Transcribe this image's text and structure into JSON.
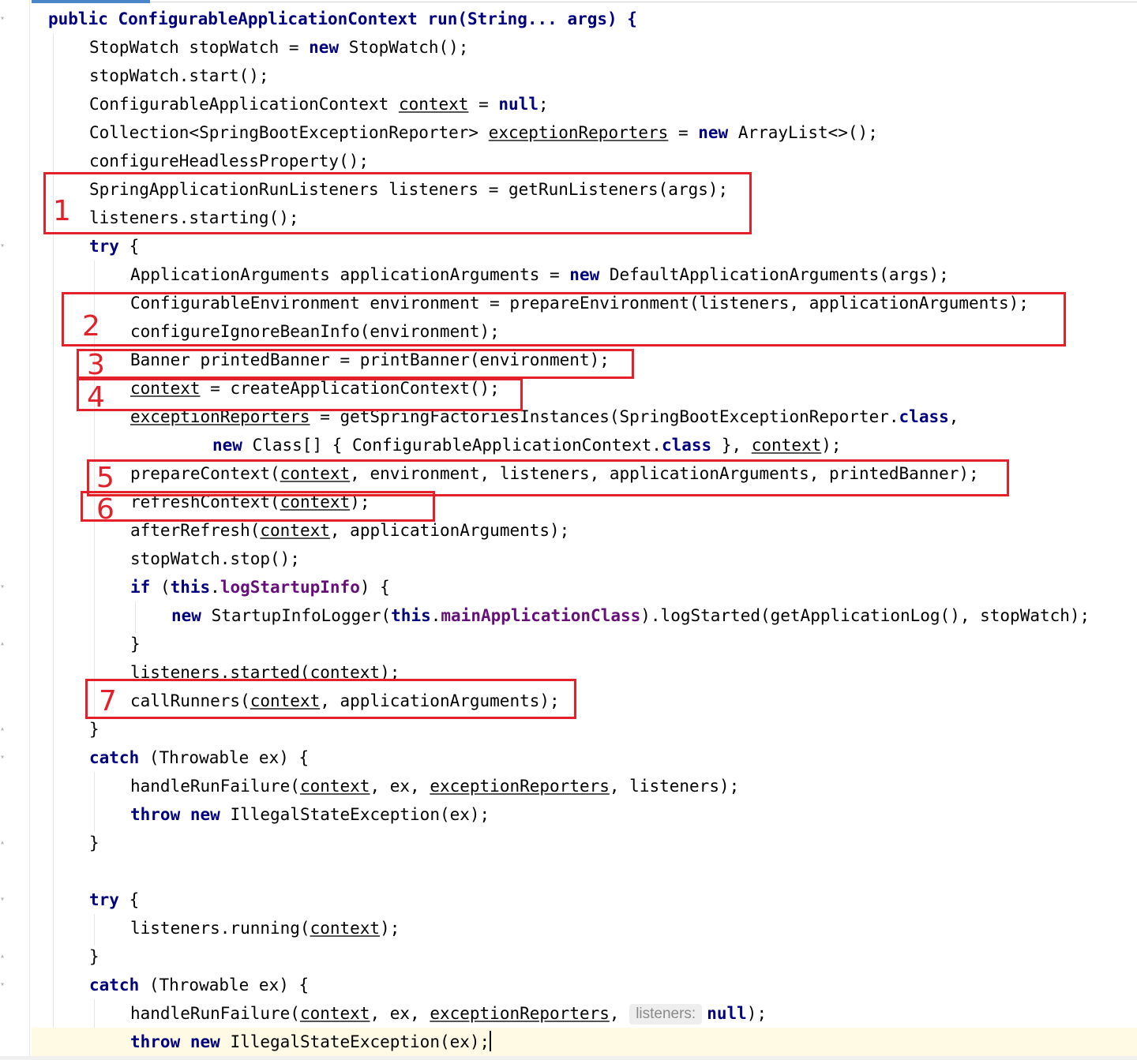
{
  "editor": {
    "lines": [
      "public ConfigurableApplicationContext run(String... args) {",
      "StopWatch stopWatch = new StopWatch();",
      "stopWatch.start();",
      "ConfigurableApplicationContext context = null;",
      "Collection<SpringBootExceptionReporter> exceptionReporters = new ArrayList<>();",
      "configureHeadlessProperty();",
      "SpringApplicationRunListeners listeners = getRunListeners(args);",
      "listeners.starting();",
      "try {",
      "ApplicationArguments applicationArguments = new DefaultApplicationArguments(args);",
      "ConfigurableEnvironment environment = prepareEnvironment(listeners, applicationArguments);",
      "configureIgnoreBeanInfo(environment);",
      "Banner printedBanner = printBanner(environment);",
      "context = createApplicationContext();",
      "exceptionReporters = getSpringFactoriesInstances(SpringBootExceptionReporter.class,",
      "new Class[] { ConfigurableApplicationContext.class }, context);",
      "prepareContext(context, environment, listeners, applicationArguments, printedBanner);",
      "refreshContext(context);",
      "afterRefresh(context, applicationArguments);",
      "stopWatch.stop();",
      "if (this.logStartupInfo) {",
      "new StartupInfoLogger(this.mainApplicationClass).logStarted(getApplicationLog(), stopWatch);",
      "}",
      "listeners.started(context);",
      "callRunners(context, applicationArguments);",
      "}",
      "catch (Throwable ex) {",
      "handleRunFailure(context, ex, exceptionReporters, listeners);",
      "throw new IllegalStateException(ex);",
      "}",
      "",
      "try {",
      "listeners.running(context);",
      "}",
      "catch (Throwable ex) {",
      "handleRunFailure(context, ex, exceptionReporters, null);",
      "throw new IllegalStateException(ex);"
    ],
    "inlay_hint": "listeners:"
  },
  "annotations": [
    "1",
    "2",
    "3",
    "4",
    "5",
    "6",
    "7"
  ],
  "colors": {
    "keyword": "#000080",
    "field": "#660e7a",
    "annotation_red": "#e3212b",
    "caret_line": "#fffae3"
  }
}
